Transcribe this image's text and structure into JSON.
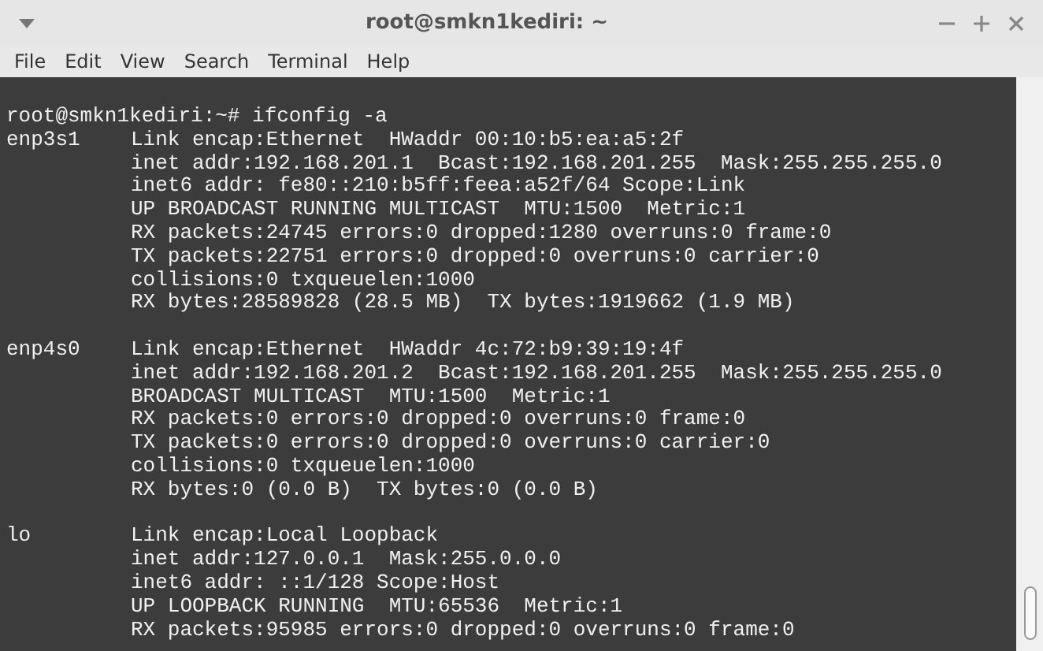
{
  "window": {
    "title": "root@smkn1kediri: ~"
  },
  "menu": [
    "File",
    "Edit",
    "View",
    "Search",
    "Terminal",
    "Help"
  ],
  "terminal": {
    "prompt": "root@smkn1kediri:~# ifconfig -a",
    "interfaces": [
      {
        "name": "enp3s1",
        "lines": [
          "Link encap:Ethernet  HWaddr 00:10:b5:ea:a5:2f",
          "inet addr:192.168.201.1  Bcast:192.168.201.255  Mask:255.255.255.0",
          "inet6 addr: fe80::210:b5ff:feea:a52f/64 Scope:Link",
          "UP BROADCAST RUNNING MULTICAST  MTU:1500  Metric:1",
          "RX packets:24745 errors:0 dropped:1280 overruns:0 frame:0",
          "TX packets:22751 errors:0 dropped:0 overruns:0 carrier:0",
          "collisions:0 txqueuelen:1000",
          "RX bytes:28589828 (28.5 MB)  TX bytes:1919662 (1.9 MB)"
        ]
      },
      {
        "name": "enp4s0",
        "lines": [
          "Link encap:Ethernet  HWaddr 4c:72:b9:39:19:4f",
          "inet addr:192.168.201.2  Bcast:192.168.201.255  Mask:255.255.255.0",
          "BROADCAST MULTICAST  MTU:1500  Metric:1",
          "RX packets:0 errors:0 dropped:0 overruns:0 frame:0",
          "TX packets:0 errors:0 dropped:0 overruns:0 carrier:0",
          "collisions:0 txqueuelen:1000",
          "RX bytes:0 (0.0 B)  TX bytes:0 (0.0 B)"
        ]
      },
      {
        "name": "lo",
        "lines": [
          "Link encap:Local Loopback",
          "inet addr:127.0.0.1  Mask:255.0.0.0",
          "inet6 addr: ::1/128 Scope:Host",
          "UP LOOPBACK RUNNING  MTU:65536  Metric:1",
          "RX packets:95985 errors:0 dropped:0 overruns:0 frame:0"
        ]
      }
    ]
  }
}
